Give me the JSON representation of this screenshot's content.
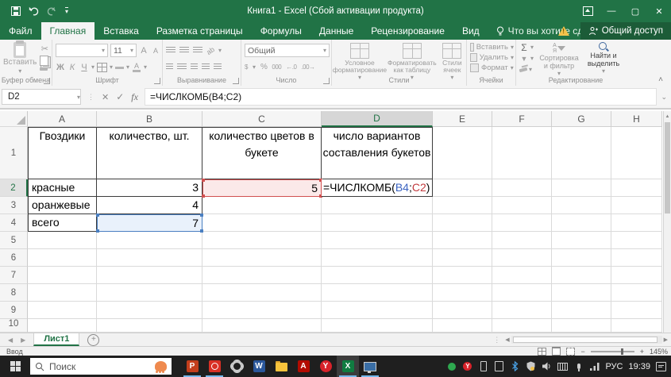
{
  "title_bar": {
    "title": "Книга1 - Excel (Сбой активации продукта)"
  },
  "tabs": {
    "file": "Файл",
    "home": "Главная",
    "insert": "Вставка",
    "page_layout": "Разметка страницы",
    "formulas": "Формулы",
    "data": "Данные",
    "review": "Рецензирование",
    "view": "Вид",
    "tell_me": "Что вы хотите сделать?",
    "share": "Общий доступ"
  },
  "ribbon": {
    "clipboard": {
      "paste": "Вставить",
      "label": "Буфер обмена"
    },
    "font": {
      "size": "11",
      "bold": "Ж",
      "italic": "К",
      "underline": "Ч",
      "grow": "А",
      "shrink": "А",
      "color_letter": "А",
      "label": "Шрифт"
    },
    "alignment": {
      "label": "Выравнивание"
    },
    "number": {
      "format": "Общий",
      "accounting": "$",
      "percent": "%",
      "thousands": "000",
      "dec_inc": "←.0",
      "dec_dec": ".00→",
      "label": "Число"
    },
    "styles": {
      "conditional": "Условное форматирование",
      "format_table": "Форматировать как таблицу",
      "cell_styles": "Стили ячеек",
      "label": "Стили"
    },
    "cells": {
      "insert": "Вставить",
      "delete": "Удалить",
      "format": "Формат",
      "label": "Ячейки"
    },
    "editing": {
      "sigma": "Σ",
      "sort_a": "А",
      "sort_z": "Я",
      "sort": "Сортировка и фильтр",
      "find": "Найти и выделить",
      "label": "Редактирование"
    }
  },
  "formula_bar": {
    "name_box": "D2",
    "fx": "fx",
    "formula": "=ЧИСЛКОМБ(B4;C2)"
  },
  "sheet": {
    "columns": [
      "A",
      "B",
      "C",
      "D",
      "E",
      "F",
      "G",
      "H"
    ],
    "rows": [
      "1",
      "2",
      "3",
      "4",
      "5",
      "6",
      "7",
      "8",
      "9",
      "10"
    ],
    "cells": {
      "a1": "Гвоздики",
      "b1": "количество, шт.",
      "c1": "количество цветов в букете",
      "d1": "число вариантов составления букетов",
      "a2": "красные",
      "b2": "3",
      "c2": "5",
      "a3": "оранжевые",
      "b3": "4",
      "a4": "всего",
      "b4": "7"
    },
    "formula": {
      "prefix": "=ЧИСЛКОМБ(",
      "ref1": "B4",
      "sep": ";",
      "ref2": "C2",
      "suffix": ")"
    }
  },
  "sheet_bar": {
    "tab": "Лист1"
  },
  "status_bar": {
    "mode": "Ввод",
    "zoom_level": "145%"
  },
  "taskbar": {
    "search": "Поиск",
    "lang": "РУС",
    "time": "19:39",
    "letters": {
      "powerpoint": "P",
      "word": "W",
      "acrobat": "A",
      "yandex": "Y",
      "excel": "X",
      "tray_yandex": "Y"
    }
  },
  "icons": {
    "dropdown": "▾",
    "close": "✕",
    "check": "✓",
    "dots": "⋮",
    "up": "▲",
    "down": "▼",
    "left": "◀",
    "right": "▶",
    "plus": "+",
    "minus": "−",
    "chevron_up": "˄",
    "chevron_down": "⌄",
    "cut": "✂",
    "minimize": "—",
    "maximize": "▢"
  },
  "colors": {
    "excel_green": "#217346",
    "ref_blue": "#3b63c1",
    "ref_red": "#c23a3e",
    "c2_fill": "#fbe9e9",
    "b4_fill": "#e9f1fb",
    "taskbar_active_underline": "#76b9ed"
  }
}
